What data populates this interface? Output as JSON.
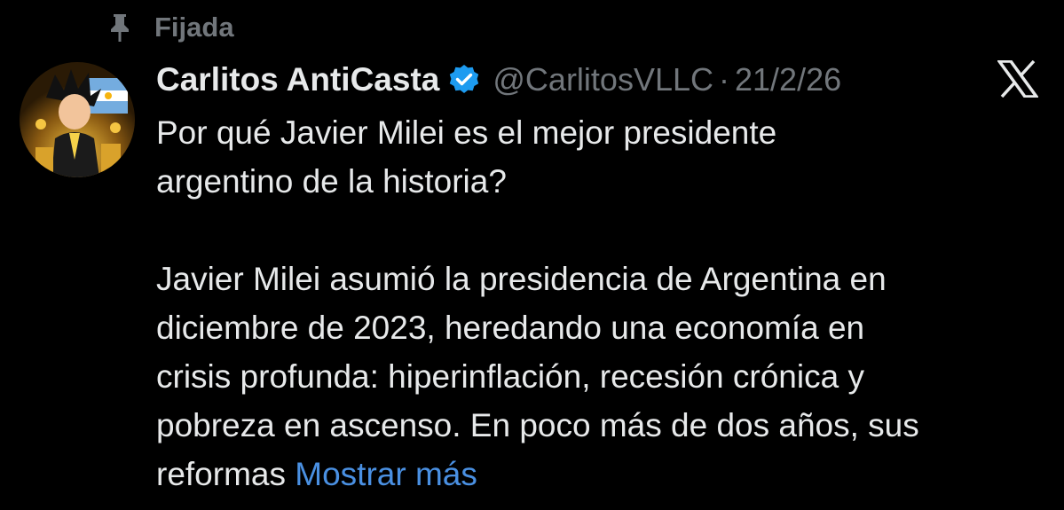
{
  "pinned": {
    "label": "Fijada",
    "icon": "pin-icon"
  },
  "author": {
    "display_name": "Carlitos AntiCasta",
    "verified_icon": "verified-badge-icon",
    "handle": "@CarlitosVLLC",
    "separator": "·",
    "date": "21/2/26"
  },
  "platform_logo": "x-logo-icon",
  "tweet": {
    "line_1": "Por qué Javier Milei es el mejor presidente",
    "line_2": "argentino de la historia?",
    "line_3": "Javier Milei asumió la presidencia de Argentina en",
    "line_4": "diciembre de 2023, heredando una economía en",
    "line_5": "crisis profunda: hiperinflación, recesión crónica y",
    "line_6": "pobreza en ascenso. En poco más de dos años, sus",
    "line_7": "reformas",
    "show_more": "Mostrar más"
  },
  "colors": {
    "background": "#000000",
    "text": "#e7e9ea",
    "muted": "#71767b",
    "link": "#4a90e2",
    "verified": "#1d9bf0"
  }
}
